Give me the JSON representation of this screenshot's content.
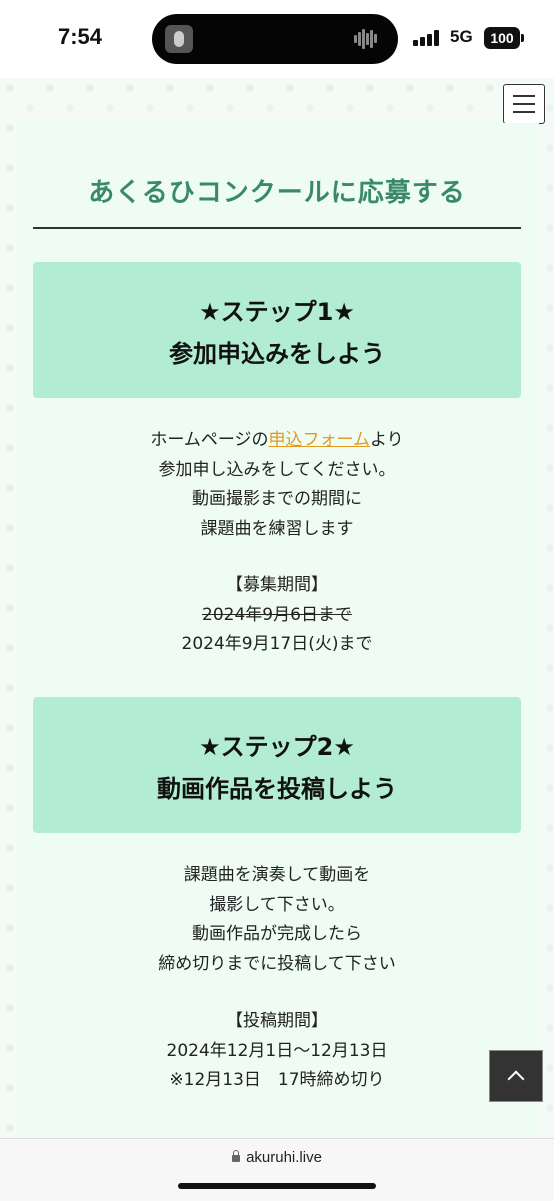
{
  "status_bar": {
    "time": "7:54",
    "network": "5G",
    "battery": "100"
  },
  "page": {
    "title": "あくるひコンクールに応募する",
    "step1": {
      "line1": "★ステップ1★",
      "line2": "参加申込みをしよう",
      "desc_pre": "ホームページの",
      "desc_link": "申込フォーム",
      "desc_post": "より",
      "desc_lines": [
        "参加申し込みをしてください。",
        "動画撮影までの期間に",
        "課題曲を練習します"
      ],
      "period_label": "【募集期間】",
      "period_old": "2024年9月6日まで",
      "period_new": "2024年9月17日(火)まで"
    },
    "step2": {
      "line1": "★ステップ2★",
      "line2": "動画作品を投稿しよう",
      "desc_lines": [
        "課題曲を演奏して動画を",
        "撮影して下さい。",
        "動画作品が完成したら",
        "締め切りまでに投稿して下さい"
      ],
      "period_label": "【投稿期間】",
      "period_range": "2024年12月1日～12月13日",
      "period_note": "※12月13日　17時締め切り"
    }
  },
  "browser": {
    "url": "akuruhi.live"
  }
}
